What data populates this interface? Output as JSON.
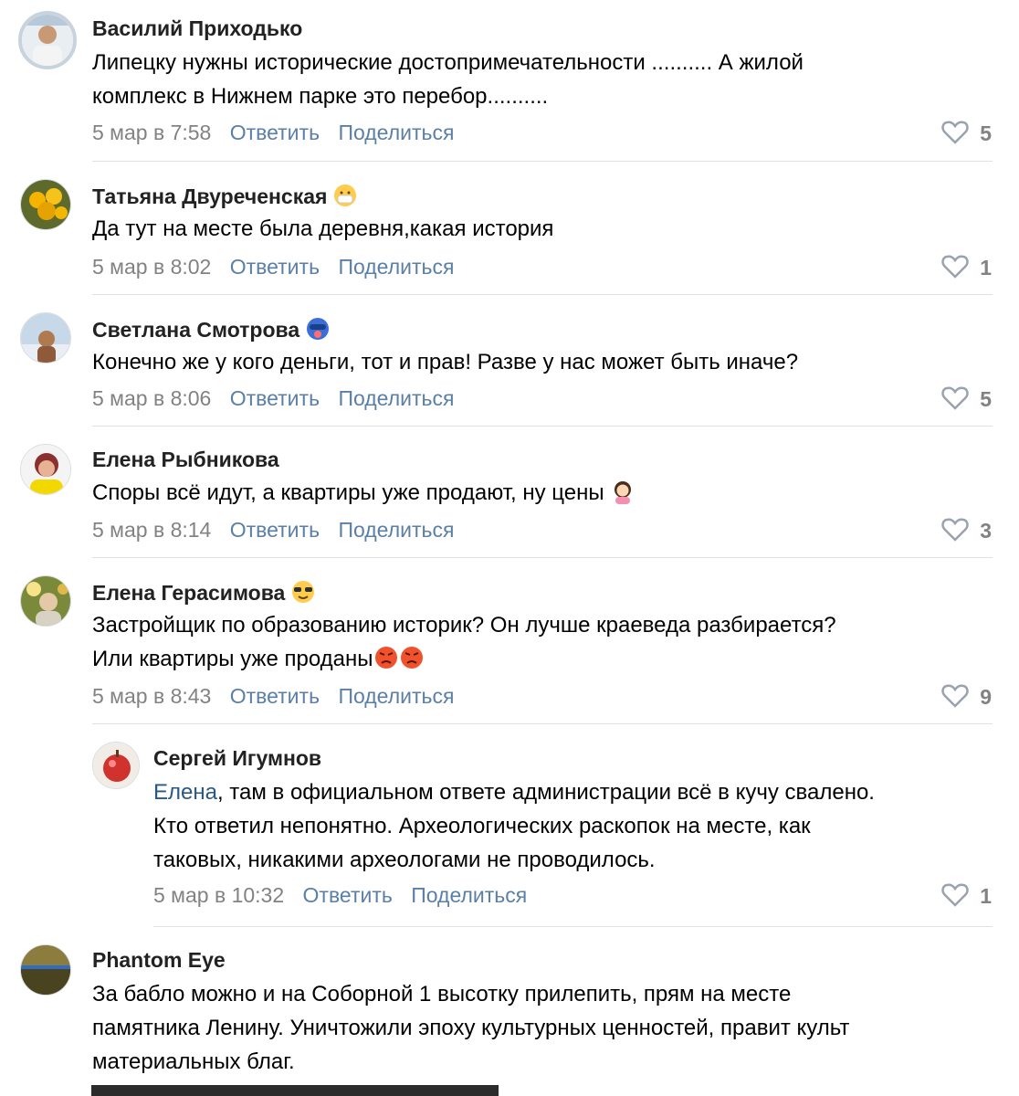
{
  "comments": [
    {
      "author": "Василий Приходько",
      "lines": [
        "Липецку нужны исторические достопримечательности .......... А жилой",
        "комплекс в Нижнем парке это перебор.........."
      ],
      "date": "5 мар в 7:58",
      "likes": "5"
    },
    {
      "author": "Татьяна Двуреченская",
      "lines": [
        "Да тут на месте была деревня,какая история"
      ],
      "date": "5 мар в 8:02",
      "likes": "1"
    },
    {
      "author": "Светлана Смотрова",
      "lines": [
        "Конечно же у кого деньги, тот и прав! Разве у нас может быть иначе?"
      ],
      "date": "5 мар в 8:06",
      "likes": "5"
    },
    {
      "author": "Елена Рыбникова",
      "lines": [
        "Споры всё идут, а квартиры уже продают, ну цены"
      ],
      "date": "5 мар в 8:14",
      "likes": "3"
    },
    {
      "author": "Елена Герасимова",
      "lines": [
        "Застройщик по образованию историк? Он лучше краеведа разбирается?",
        "Или квартиры уже проданы"
      ],
      "date": "5 мар в 8:43",
      "likes": "9"
    },
    {
      "author": "Сергей Игумнов",
      "mention": "Елена",
      "lines": [
        ", там в официальном ответе администрации всё в кучу свалено.",
        "Кто ответил непонятно. Археологических раскопок на месте, как",
        "таковых, никакими археологами не проводилось."
      ],
      "date": "5 мар в 10:32",
      "likes": "1"
    },
    {
      "author": "Phantom Eye",
      "lines": [
        "За бабло можно и на Соборной 1 высотку прилепить, прям на месте",
        "памятника Ленину. Уничтожили эпоху культурных ценностей, правит культ",
        "материальных благ."
      ]
    }
  ],
  "actions": {
    "reply": "Ответить",
    "share": "Поделиться"
  },
  "icons": {
    "like": "heart-outline-icon"
  },
  "colors": {
    "link": "#5b7fa6",
    "date": "#828282",
    "mention": "#2a5885",
    "separator": "#dce1e6"
  }
}
